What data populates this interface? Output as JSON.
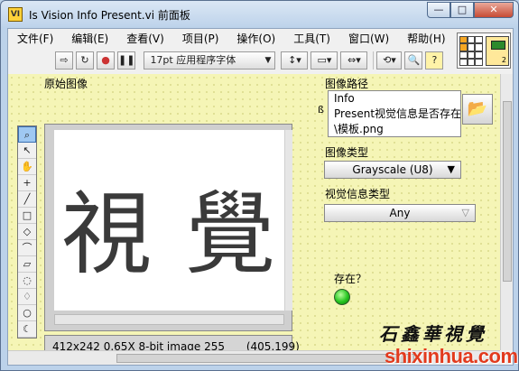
{
  "window": {
    "title": "Is Vision Info Present.vi 前面板",
    "icon_label": "VI",
    "controls": {
      "minimize": "—",
      "maximize": "□",
      "close": "✕"
    }
  },
  "menubar": [
    "文件(F)",
    "编辑(E)",
    "查看(V)",
    "项目(P)",
    "操作(O)",
    "工具(T)",
    "窗口(W)",
    "帮助(H)"
  ],
  "toolbar": {
    "run_icon": "⇨",
    "run_continuous_icon": "↻",
    "abort_icon": "●",
    "pause_icon": "❚❚",
    "font": "17pt 应用程序字体",
    "font_arrow": "▼",
    "align_label": "↕▾",
    "distribute_label": "▭▾",
    "resize_label": "⇔▾",
    "reorder_label": "⟲▾",
    "search_icon": "🔍",
    "help_icon": "?"
  },
  "connector": {
    "icon_number": "2"
  },
  "front_panel": {
    "image_display_label": "原始图像",
    "image_path_label": "图像路径",
    "image_path_lines": [
      "Info",
      "Present视觉信息是否存在",
      "\\模板.png"
    ],
    "image_path_prefix": "ß",
    "browse_icon": "📂",
    "image_type_label": "图像类型",
    "image_type_value": "Grayscale (U8)",
    "image_type_arrow": "▼",
    "vision_info_type_label": "视觉信息类型",
    "vision_info_type_value": "Any",
    "vision_info_type_arrow": "▽",
    "exists_label": "存在？",
    "led_color": "#25c520",
    "status": {
      "image_info": "412x242 0.65X 8-bit image 255",
      "coordinates": "(405,199)"
    },
    "image_content": [
      "視",
      "覺"
    ]
  },
  "tools": [
    "⌕",
    "↖",
    "✋",
    "+",
    "╱",
    "□",
    "◇",
    "⌒",
    "▱",
    "◌",
    "♢",
    "○",
    "☾"
  ],
  "watermark": {
    "calligraphy": "石鑫華視覺",
    "url": "shixinhua.com"
  }
}
